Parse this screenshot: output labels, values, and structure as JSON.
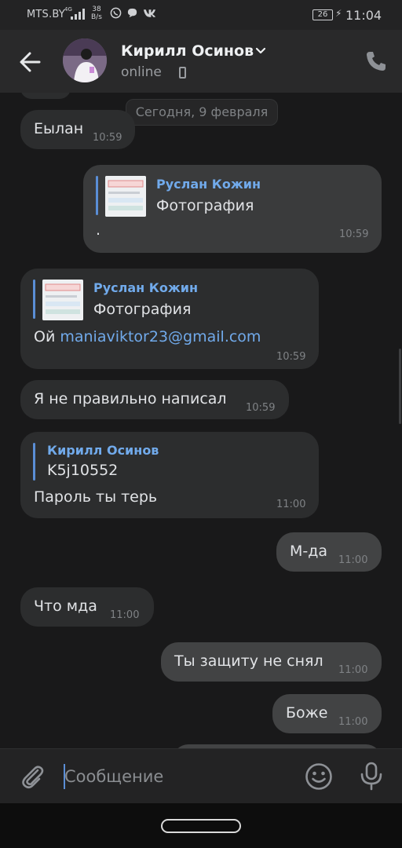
{
  "status_bar": {
    "carrier": "MTS.BY",
    "network": "4G",
    "speed_value": "38",
    "speed_unit": "B/s",
    "battery": "26",
    "time": "11:04",
    "app_icons": [
      "viber-icon",
      "chat-icon",
      "vk-icon"
    ]
  },
  "header": {
    "contact_name": "Кирилл Осинов",
    "status": "online"
  },
  "chat": {
    "date_separator": "Сегодня, 9 февраля",
    "messages": [
      {
        "direction": "in",
        "text": "Еылан",
        "time": "10:59"
      },
      {
        "direction": "out",
        "forward_author": "Руслан Кожин",
        "forward_text": "Фотография",
        "text": ".",
        "time": "10:59"
      },
      {
        "direction": "in",
        "forward_author": "Руслан Кожин",
        "forward_text": "Фотография",
        "text_prefix": "Ой ",
        "link": "maniaviktor23@gmail.com",
        "time": "10:59"
      },
      {
        "direction": "in",
        "text": "Я не правильно написал",
        "time": "10:59"
      },
      {
        "direction": "in",
        "forward_author": "Кирилл Осинов",
        "forward_text": "K5j10552",
        "text": "Пароль ты терь",
        "time": "11:00"
      },
      {
        "direction": "out",
        "text": "М-да",
        "time": "11:00"
      },
      {
        "direction": "in",
        "text": "Что мда",
        "time": "11:00"
      },
      {
        "direction": "out",
        "text": "Ты защиту не снял",
        "time": "11:00"
      },
      {
        "direction": "out",
        "text": "Боже",
        "time": "11:00"
      }
    ]
  },
  "composer": {
    "placeholder": "Сообщение"
  },
  "colors": {
    "background": "#19191a",
    "bubble_in": "#2c2d2e",
    "bubble_out": "#424344",
    "accent": "#71aaeb"
  }
}
